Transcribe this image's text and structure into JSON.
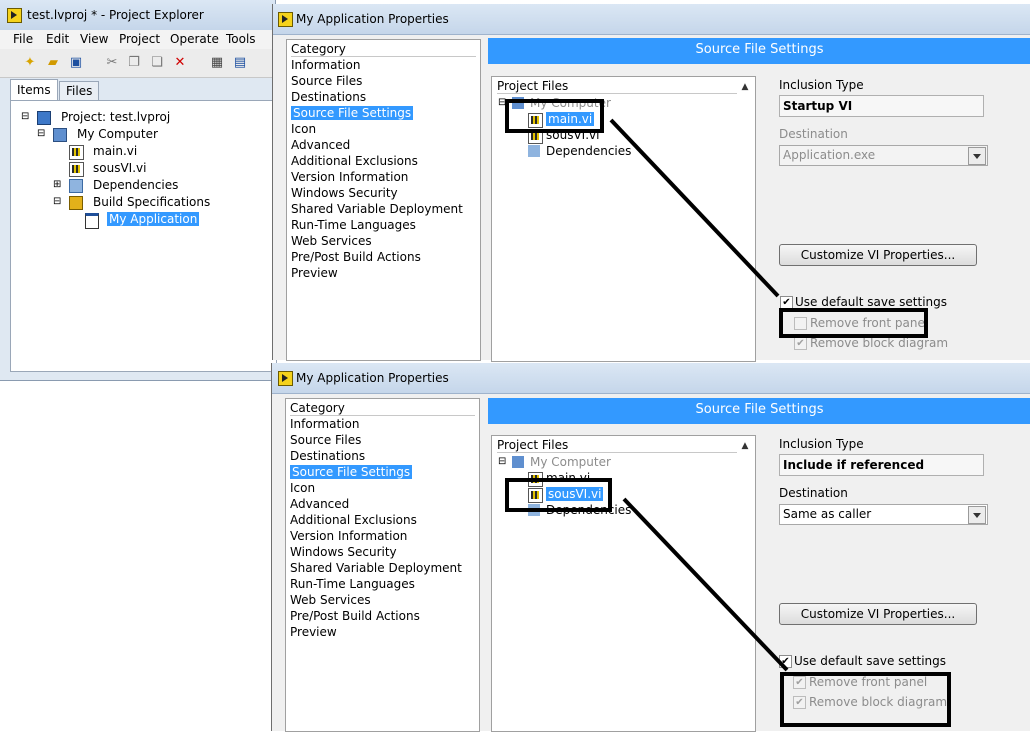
{
  "explorer": {
    "title": "test.lvproj * - Project Explorer",
    "menu": [
      "File",
      "Edit",
      "View",
      "Project",
      "Operate",
      "Tools"
    ],
    "tabs": [
      "Items",
      "Files"
    ],
    "tree": [
      {
        "label": "Project: test.lvproj"
      },
      {
        "label": "My Computer"
      },
      {
        "label": "main.vi"
      },
      {
        "label": "sousVI.vi"
      },
      {
        "label": "Dependencies"
      },
      {
        "label": "Build Specifications"
      },
      {
        "label": "My Application"
      }
    ]
  },
  "dialog_top": {
    "title": "My Application Properties",
    "category_header": "Category",
    "categories": [
      "Information",
      "Source Files",
      "Destinations",
      "Source File Settings",
      "Icon",
      "Advanced",
      "Additional Exclusions",
      "Version Information",
      "Windows Security",
      "Shared Variable Deployment",
      "Run-Time Languages",
      "Web Services",
      "Pre/Post Build Actions",
      "Preview"
    ],
    "section_title": "Source File Settings",
    "project_files_header": "Project Files",
    "files": [
      "My Computer",
      "main.vi",
      "sousVI.vi",
      "Dependencies"
    ],
    "inclusion_label": "Inclusion Type",
    "inclusion_value": "Startup VI",
    "destination_label": "Destination",
    "destination_value": "Application.exe",
    "customize_button": "Customize VI Properties...",
    "use_default": "Use default save settings",
    "remove_front": "Remove front panel",
    "remove_block": "Remove block diagram"
  },
  "dialog_bottom": {
    "title": "My Application Properties",
    "category_header": "Category",
    "categories": [
      "Information",
      "Source Files",
      "Destinations",
      "Source File Settings",
      "Icon",
      "Advanced",
      "Additional Exclusions",
      "Version Information",
      "Windows Security",
      "Shared Variable Deployment",
      "Run-Time Languages",
      "Web Services",
      "Pre/Post Build Actions",
      "Preview"
    ],
    "section_title": "Source File Settings",
    "project_files_header": "Project Files",
    "files": [
      "My Computer",
      "main.vi",
      "sousVI.vi",
      "Dependencies"
    ],
    "inclusion_label": "Inclusion Type",
    "inclusion_value": "Include if referenced",
    "destination_label": "Destination",
    "destination_value": "Same as caller",
    "customize_button": "Customize VI Properties...",
    "use_default": "Use default save settings",
    "remove_front": "Remove front panel",
    "remove_block": "Remove block diagram"
  },
  "colors": {
    "selection": "#3399ff",
    "header_bar": "#3399ff",
    "annotation": "#000000"
  },
  "icons": [
    "labview-icon",
    "new-icon",
    "open-icon",
    "save-icon",
    "cut-icon",
    "copy-icon",
    "paste-icon",
    "delete-icon",
    "build-icon",
    "vi-file-icon",
    "computer-icon",
    "dependencies-icon",
    "build-spec-icon",
    "application-icon"
  ]
}
